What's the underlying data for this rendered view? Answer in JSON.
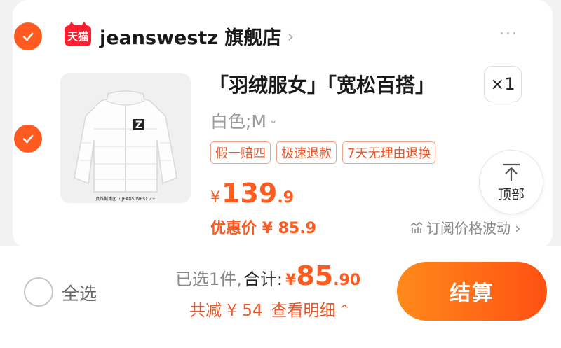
{
  "shop": {
    "logo_text": "天猫",
    "name": "jeanswestz 旗舰店",
    "chevron": "›",
    "more": "···"
  },
  "item": {
    "title": "「羽绒服女」「宽松百搭」",
    "quantity": "×1",
    "sku": "白色;M",
    "tags": [
      "假一赔四",
      "极速退款",
      "7天无理由退换"
    ],
    "price_symbol": "¥",
    "price_int": "139",
    "price_dec": ".9",
    "coupon_price": "优惠价 ¥ 85.9",
    "subscribe": "订阅价格波动 ›",
    "image_logo_letter": "Z",
    "image_caption": "真维斯集团 • JEANS WEST Z+"
  },
  "back_to_top": {
    "label": "顶部"
  },
  "footer": {
    "select_all": "全选",
    "selected": "已选1件,",
    "total_label": "合计:",
    "total_symbol": "¥",
    "total_int": "85",
    "total_dec": ".90",
    "discount": "共减 ¥ 54",
    "detail": "查看明细",
    "detail_arrow": "^",
    "checkout": "结算"
  },
  "colors": {
    "accent": "#ff5a1f",
    "tmall_red": "#ff1e2d"
  },
  "icons": [
    "check-icon",
    "tmall-logo",
    "chevron-right-icon",
    "more-dots-icon",
    "chevron-down-icon",
    "trend-icon",
    "arrow-up-icon",
    "chevron-up-icon"
  ]
}
